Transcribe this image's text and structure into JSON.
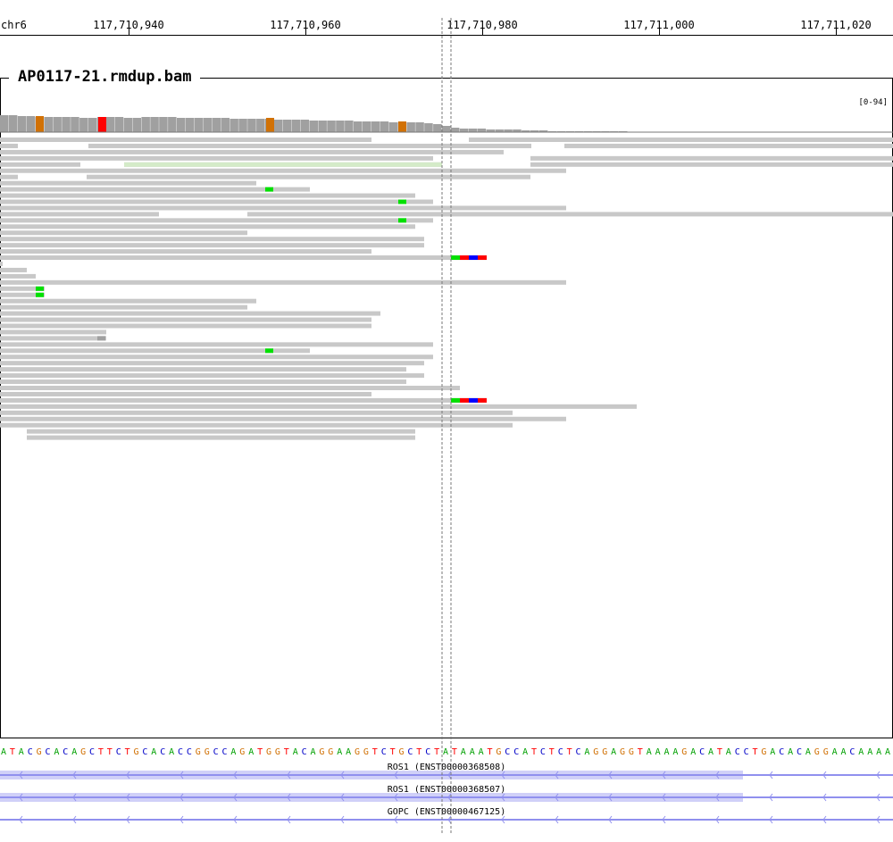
{
  "ruler": {
    "chromosome": "chr6",
    "ticks": [
      {
        "pos": 117710940,
        "label": "117,710,940"
      },
      {
        "pos": 117710960,
        "label": "117,710,960"
      },
      {
        "pos": 117710980,
        "label": "117,710,980"
      },
      {
        "pos": 117711000,
        "label": "117,711,000"
      },
      {
        "pos": 117711020,
        "label": "117,711,020"
      }
    ]
  },
  "alignment_track": {
    "name": "AP0117-21.rmdup.bam",
    "coverage_range": "[0-94]"
  },
  "sequence": "ATACGCACAGCTTCTGCACACCGGCCAGATGGTACAGGAAGGTCTGCTCTATAAATGCCATCTCTCAGGAGGTAAAAGACATACCTGACACAGGAACAAAA",
  "colors": {
    "A": "#00a000",
    "C": "#0000c8",
    "G": "#d17105",
    "T": "#ff0000",
    "read": "#c8c8c8",
    "transcript": "#9090ee"
  },
  "genes": [
    {
      "name": "ROS1 (ENST00000368508)"
    },
    {
      "name": "ROS1 (ENST00000368507)"
    },
    {
      "name": "GOPC (ENST00000467125)"
    }
  ]
}
